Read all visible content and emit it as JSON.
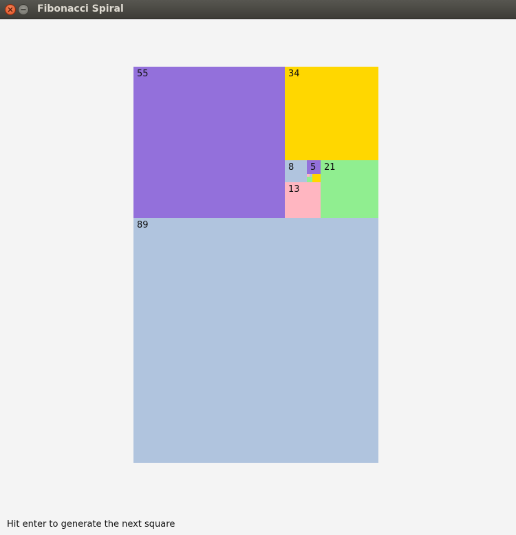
{
  "window": {
    "title": "Fibonacci Spiral"
  },
  "squares": [
    {
      "id": "sq-89",
      "value": 89,
      "label": "89",
      "color": "#b0c4de"
    },
    {
      "id": "sq-55",
      "value": 55,
      "label": "55",
      "color": "#9370db"
    },
    {
      "id": "sq-34",
      "value": 34,
      "label": "34",
      "color": "#ffd700"
    },
    {
      "id": "sq-21",
      "value": 21,
      "label": "21",
      "color": "#90ee90"
    },
    {
      "id": "sq-13",
      "value": 13,
      "label": "13",
      "color": "#ffb6c1"
    },
    {
      "id": "sq-8",
      "value": 8,
      "label": "8",
      "color": "#b0c4de"
    },
    {
      "id": "sq-5",
      "value": 5,
      "label": "5",
      "color": "#9370db"
    },
    {
      "id": "sq-3",
      "value": 3,
      "label": "",
      "color": "#ffd700"
    },
    {
      "id": "sq-2",
      "value": 2,
      "label": "",
      "color": "#90ee90"
    },
    {
      "id": "sq-1a",
      "value": 1,
      "label": "",
      "color": "#ffb6c1"
    },
    {
      "id": "sq-1b",
      "value": 1,
      "label": "",
      "color": "#b0c4de"
    }
  ],
  "status": {
    "text": "Hit enter to generate the next square"
  },
  "colors": {
    "background": "#f4f4f4",
    "titlebar": "#4a4944",
    "close_button": "#df4c21"
  },
  "icons": {
    "close": "close-icon",
    "minimize": "minimize-icon"
  }
}
